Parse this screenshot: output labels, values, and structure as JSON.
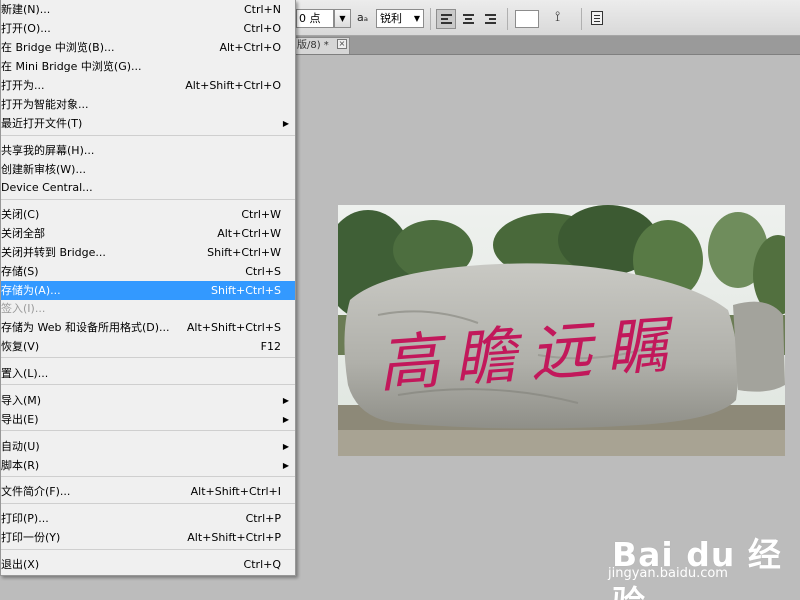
{
  "options_bar": {
    "font_size_value": "0 点",
    "antialias_label": "aₐ",
    "antialias_value": "锐利",
    "text_color": "#ffffff"
  },
  "document_tab": {
    "title": "版/8) *",
    "close_glyph": "×"
  },
  "file_menu": {
    "items": [
      {
        "label": "新建(N)...",
        "shortcut": "Ctrl+N"
      },
      {
        "label": "打开(O)...",
        "shortcut": "Ctrl+O"
      },
      {
        "label": "在 Bridge 中浏览(B)...",
        "shortcut": "Alt+Ctrl+O"
      },
      {
        "label": "在 Mini Bridge 中浏览(G)...",
        "shortcut": ""
      },
      {
        "label": "打开为...",
        "shortcut": "Alt+Shift+Ctrl+O"
      },
      {
        "label": "打开为智能对象...",
        "shortcut": ""
      },
      {
        "label": "最近打开文件(T)",
        "shortcut": ""
      },
      {
        "label": "共享我的屏幕(H)...",
        "shortcut": ""
      },
      {
        "label": "创建新审核(W)...",
        "shortcut": ""
      },
      {
        "label": "Device Central...",
        "shortcut": ""
      },
      {
        "label": "关闭(C)",
        "shortcut": "Ctrl+W"
      },
      {
        "label": "关闭全部",
        "shortcut": "Alt+Ctrl+W"
      },
      {
        "label": "关闭并转到 Bridge...",
        "shortcut": "Shift+Ctrl+W"
      },
      {
        "label": "存储(S)",
        "shortcut": "Ctrl+S"
      },
      {
        "label": "存储为(A)...",
        "shortcut": "Shift+Ctrl+S"
      },
      {
        "label": "签入(I)...",
        "shortcut": ""
      },
      {
        "label": "存储为 Web 和设备所用格式(D)...",
        "shortcut": "Alt+Shift+Ctrl+S"
      },
      {
        "label": "恢复(V)",
        "shortcut": "F12"
      },
      {
        "label": "置入(L)...",
        "shortcut": ""
      },
      {
        "label": "导入(M)",
        "shortcut": ""
      },
      {
        "label": "导出(E)",
        "shortcut": ""
      },
      {
        "label": "自动(U)",
        "shortcut": ""
      },
      {
        "label": "脚本(R)",
        "shortcut": ""
      },
      {
        "label": "文件简介(F)...",
        "shortcut": "Alt+Shift+Ctrl+I"
      },
      {
        "label": "打印(P)...",
        "shortcut": "Ctrl+P"
      },
      {
        "label": "打印一份(Y)",
        "shortcut": "Alt+Shift+Ctrl+P"
      },
      {
        "label": "退出(X)",
        "shortcut": "Ctrl+Q"
      }
    ],
    "highlighted_item": "存储为(A)...",
    "highlight_color": "#3399ff",
    "submenu_arrow": "▶"
  },
  "photo": {
    "stone_inscription": "高瞻远瞩",
    "inscription_color": "#c2185b"
  },
  "watermark": {
    "brand": "Bai du 经验",
    "url": "jingyan.baidu.com"
  }
}
